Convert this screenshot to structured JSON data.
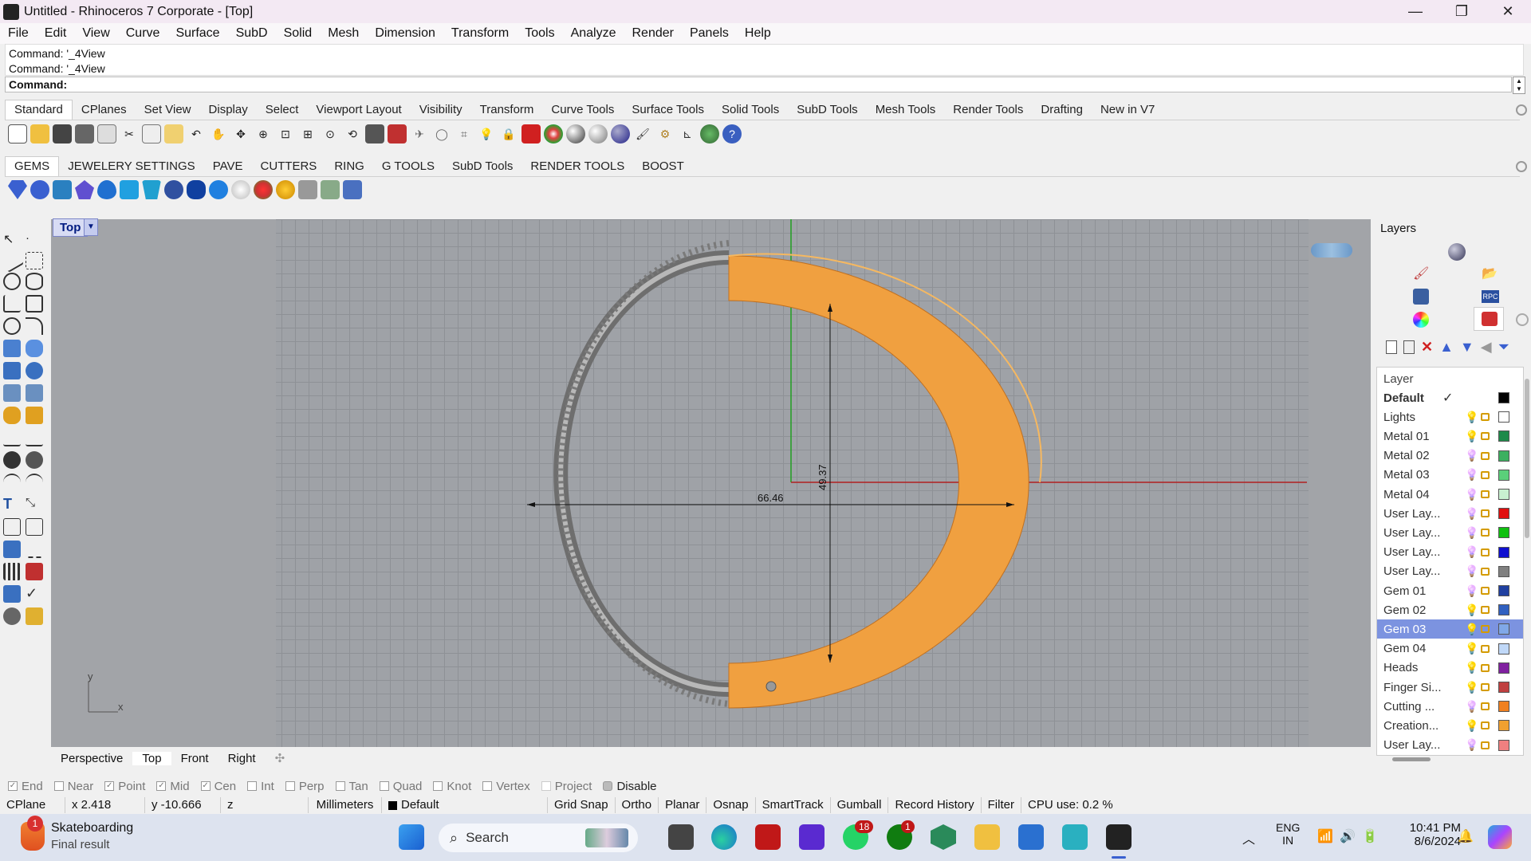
{
  "window": {
    "title": "Untitled - Rhinoceros 7 Corporate - [Top]",
    "minimize": "—",
    "maximize": "❐",
    "close": "✕"
  },
  "menu": [
    "File",
    "Edit",
    "View",
    "Curve",
    "Surface",
    "SubD",
    "Solid",
    "Mesh",
    "Dimension",
    "Transform",
    "Tools",
    "Analyze",
    "Render",
    "Panels",
    "Help"
  ],
  "command": {
    "history": [
      "Command: '_4View",
      "Command: '_4View"
    ],
    "prompt": "Command:"
  },
  "toolbar_tabs": [
    "Standard",
    "CPlanes",
    "Set View",
    "Display",
    "Select",
    "Viewport Layout",
    "Visibility",
    "Transform",
    "Curve Tools",
    "Surface Tools",
    "Solid Tools",
    "SubD Tools",
    "Mesh Tools",
    "Render Tools",
    "Drafting",
    "New in V7"
  ],
  "plugin_tabs": [
    "GEMS",
    "JEWELERY SETTINGS",
    "PAVE",
    "CUTTERS",
    "RING",
    "G TOOLS",
    "SubD Tools",
    "RENDER TOOLS",
    "BOOST"
  ],
  "viewport": {
    "name": "Top",
    "dimension_h": "66.46",
    "dimension_v": "49.37",
    "axis_y": "y",
    "axis_x": "x"
  },
  "viewport_tabs": [
    "Perspective",
    "Top",
    "Front",
    "Right"
  ],
  "osnaps": [
    {
      "label": "End",
      "checked": true
    },
    {
      "label": "Near",
      "checked": false
    },
    {
      "label": "Point",
      "checked": true
    },
    {
      "label": "Mid",
      "checked": true
    },
    {
      "label": "Cen",
      "checked": true
    },
    {
      "label": "Int",
      "checked": false
    },
    {
      "label": "Perp",
      "checked": false
    },
    {
      "label": "Tan",
      "checked": false
    },
    {
      "label": "Quad",
      "checked": false
    },
    {
      "label": "Knot",
      "checked": false
    },
    {
      "label": "Vertex",
      "checked": false
    },
    {
      "label": "Project",
      "checked": false
    }
  ],
  "osnap_disable": "Disable",
  "status": {
    "cplane": "CPlane",
    "x": "x 2.418",
    "y": "y -10.666",
    "z": "z",
    "units": "Millimeters",
    "layer": "Default",
    "toggles": [
      "Grid Snap",
      "Ortho",
      "Planar",
      "Osnap",
      "SmartTrack",
      "Gumball",
      "Record History",
      "Filter"
    ],
    "cpu": "CPU use: 0.2 %"
  },
  "layers": {
    "panel_title": "Layers",
    "header": "Layer",
    "rows": [
      {
        "name": "Default",
        "color": "#000000",
        "bulb": "#d4a000",
        "bold": true
      },
      {
        "name": "Lights",
        "color": "#ffffff",
        "bulb": "#d4a000"
      },
      {
        "name": "Metal 01",
        "color": "#1e8a4a",
        "bulb": "#d4a000"
      },
      {
        "name": "Metal 02",
        "color": "#3cb060",
        "bulb": "#3a6fd0"
      },
      {
        "name": "Metal 03",
        "color": "#5ad07a",
        "bulb": "#3a6fd0"
      },
      {
        "name": "Metal 04",
        "color": "#c8f0d0",
        "bulb": "#3a6fd0"
      },
      {
        "name": "User Lay...",
        "color": "#e01010",
        "bulb": "#3a6fd0"
      },
      {
        "name": "User Lay...",
        "color": "#10c010",
        "bulb": "#3a6fd0"
      },
      {
        "name": "User Lay...",
        "color": "#1010d0",
        "bulb": "#3a6fd0"
      },
      {
        "name": "User Lay...",
        "color": "#808080",
        "bulb": "#3a6fd0"
      },
      {
        "name": "Gem 01",
        "color": "#2040a0",
        "bulb": "#3a6fd0"
      },
      {
        "name": "Gem 02",
        "color": "#3060c0",
        "bulb": "#d4a000"
      },
      {
        "name": "Gem 03",
        "color": "#80a8e8",
        "bulb": "#d4a000",
        "selected": true
      },
      {
        "name": "Gem 04",
        "color": "#c0d8f8",
        "bulb": "#d4a000"
      },
      {
        "name": "Heads",
        "color": "#8020a0",
        "bulb": "#d4a000"
      },
      {
        "name": "Finger Si...",
        "color": "#c04040",
        "bulb": "#d4a000"
      },
      {
        "name": "Cutting ...",
        "color": "#f08020",
        "bulb": "#3a6fd0"
      },
      {
        "name": "Creation...",
        "color": "#f0a030",
        "bulb": "#d4a000"
      },
      {
        "name": "User Lay...",
        "color": "#f08080",
        "bulb": "#3a6fd0"
      }
    ]
  },
  "taskbar": {
    "weather_title": "Skateboarding",
    "weather_sub": "Final result",
    "search": "Search",
    "lang1": "ENG",
    "lang2": "IN",
    "time": "10:41 PM",
    "date": "8/6/2024",
    "badge_whatsapp": "18",
    "badge_xbox": "1",
    "badge_weather": "1"
  }
}
